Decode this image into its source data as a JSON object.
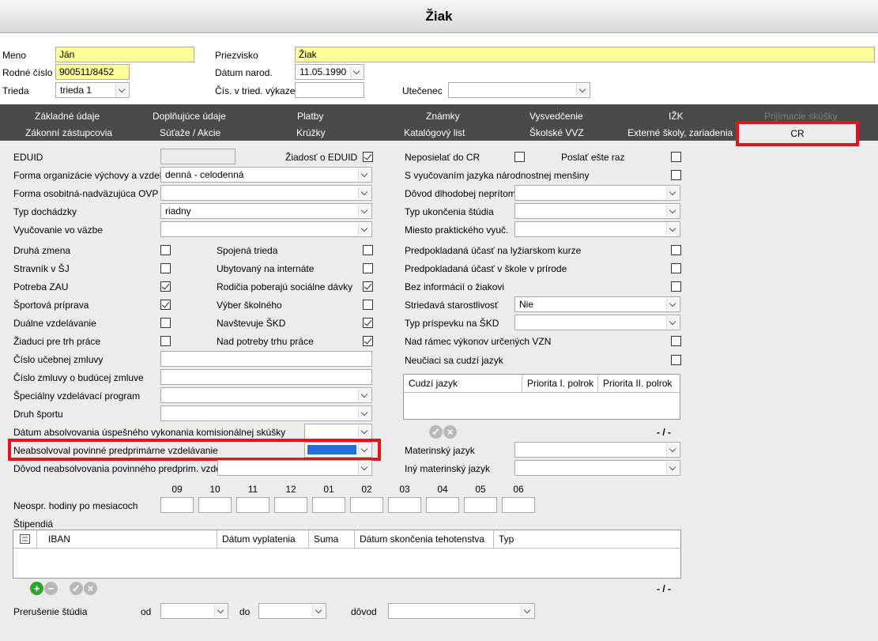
{
  "window": {
    "title": "Žiak"
  },
  "header": {
    "meno_label": "Meno",
    "meno_value": "Ján",
    "priezvisko_label": "Priezvisko",
    "priezvisko_value": "Žiak",
    "rodne_cislo_label": "Rodné číslo",
    "rodne_cislo_value": "900511/8452",
    "datum_narod_label": "Dátum narod.",
    "datum_narod_value": "11.05.1990",
    "trieda_label": "Trieda",
    "trieda_value": "trieda 1",
    "cis_triedny_label": "Čís. v tried. výkaze",
    "cis_triedny_value": "",
    "utecenec_label": "Utečenec",
    "utecenec_value": ""
  },
  "tabs": {
    "row1": [
      "Základné údaje",
      "Doplňujúce údaje",
      "Platby",
      "Známky",
      "Vysvedčenie",
      "IŽK",
      "Prijímacie skúšky"
    ],
    "row2": [
      "Zákonní zástupcovia",
      "Súťaže / Akcie",
      "Krúžky",
      "Katalógový list",
      "Školské VVZ",
      "Externé školy, zariadenia"
    ],
    "active": "CR"
  },
  "left": {
    "eduid": "EDUID",
    "ziadost_eduid": "Žiadosť o EDUID",
    "forma_org": "Forma organizácie výchovy a vzdel.",
    "forma_org_value": "denná - celodenná",
    "forma_ovp": "Forma osobitná-nadväzujúca OVP",
    "typ_dochadzky": "Typ dochádzky",
    "typ_dochadzky_value": "riadny",
    "vyucovanie_vazbe": "Vyučovanie vo väzbe",
    "druha_zmena": "Druhá zmena",
    "spojena_trieda": "Spojená trieda",
    "stravnik": "Stravník v ŠJ",
    "ubytovany": "Ubytovaný na internáte",
    "potreba_zau": "Potreba ZAU",
    "rodicia_soc": "Rodičia poberajú sociálne dávky",
    "sportova": "Športová príprava",
    "vyber_skolneho": "Výber školného",
    "dualne": "Duálne vzdelávanie",
    "navstevuje_skd": "Navštevuje ŠKD",
    "ziaduci": "Žiaduci pre trh práce",
    "nad_potreby": "Nad potreby trhu práce",
    "cislo_ucebnej": "Číslo učebnej zmluvy",
    "cislo_buducej": "Číslo zmluvy o budúcej zmluve",
    "specialny": "Špeciálny vzdelávací program",
    "druh_sportu": "Druh športu",
    "datum_absolv": "Dátum absolvovania úspešného vykonania komisionálnej skúšky",
    "neabsolvoval": "Neabsolvoval povinné predprimárne vzdelávanie",
    "dovod_neabs": "Dôvod neabsolvovania povinného predprim. vzdel.",
    "neospr": "Neospr. hodiny po mesiacoch",
    "months": [
      "09",
      "10",
      "11",
      "12",
      "01",
      "02",
      "03",
      "04",
      "05",
      "06"
    ],
    "stipendia": "Štipendiá",
    "stip_cols": [
      "IBAN",
      "Dátum vyplatenia",
      "Suma",
      "Dátum skončenia tehotenstva",
      "Typ"
    ],
    "paging": "- / -",
    "prerusenie": "Prerušenie štúdia",
    "od": "od",
    "do": "do",
    "dovod": "dôvod"
  },
  "right": {
    "neposielat": "Neposielať do CR",
    "poslat_este": "Poslať ešte raz",
    "s_vyucovanim": "S vyučovaním jazyka národnostnej menšiny",
    "dovod_dlh": "Dôvod dlhodobej neprítom.",
    "typ_ukoncenia": "Typ ukončenia štúdia",
    "miesto_prakt": "Miesto praktického vyuč.",
    "lyziarsky": "Predpokladaná účasť na lyžiarskom kurze",
    "skola_prirode": "Predpokladaná účasť v škole v prírode",
    "bez_info": "Bez informácií o žiakovi",
    "striedava": "Striedavá starostlivosť",
    "striedava_value": "Nie",
    "typ_prispevku": "Typ príspevku na ŠKD",
    "nad_ramec": "Nad rámec výkonov určených VZN",
    "neuciaci": "Neučiaci sa cudzí jazyk",
    "lang_cols": [
      "Cudzí jazyk",
      "Priorita I. polrok",
      "Priorita II. polrok"
    ],
    "paging": "- / -",
    "materinsky": "Materinský jazyk",
    "iny_materinsky": "Iný materinský jazyk"
  },
  "colors": {
    "highlight": "#e2141e",
    "tabbar": "#4a4a4a",
    "selected": "#1e6fd6",
    "yellow": "#ffff99"
  }
}
